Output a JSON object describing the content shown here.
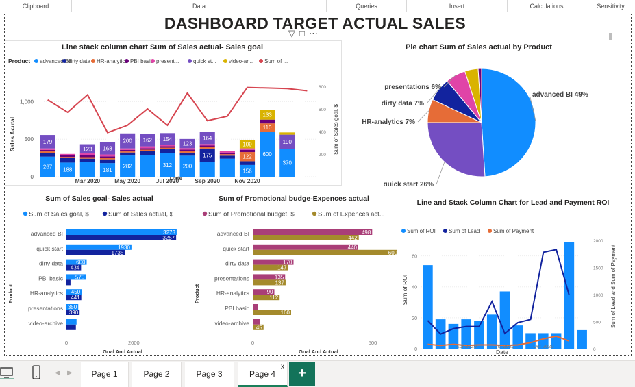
{
  "ribbon": {
    "items": [
      "Clipboard",
      "Data",
      "Queries",
      "Insert",
      "Calculations",
      "Sensitivity"
    ]
  },
  "dashboard": {
    "title": "DASHBOARD TARGET ACTUAL SALES"
  },
  "colors": {
    "advanced_bi": "#118DFF",
    "dirty_data": "#12239E",
    "hr_analytics": "#E66C37",
    "pbi_basic": "#6B007B",
    "presentations": "#E044A7",
    "quick_start": "#744EC2",
    "video_archive": "#D9B300",
    "goal_line": "#D64550",
    "budget": "#A93E78",
    "expences": "#A48A2C"
  },
  "chart_data": [
    {
      "id": "line-stack",
      "type": "bar",
      "title": "Line stack column chart Sum of Sales actual- Sales goal",
      "xlabel": "Date",
      "ylabel": "Sales Acutal",
      "y2label": "Sum of Sales goal, $",
      "legend_title": "Product",
      "legend": [
        "advanced BI",
        "dirty data",
        "HR-analytics",
        "PBI basic",
        "present...",
        "quick st...",
        "video-ar...",
        "Sum of ..."
      ],
      "x_ticks": [
        "Mar 2020",
        "May 2020",
        "Jul 2020",
        "Sep 2020",
        "Nov 2020"
      ],
      "y_ticks": [
        "0",
        "500",
        "1,000"
      ],
      "y2_ticks": [
        "200",
        "400",
        "600",
        "800"
      ],
      "ylim": [
        0,
        1250
      ],
      "y2lim": [
        0,
        830
      ],
      "categories": [
        "Jan 2020",
        "Feb 2020",
        "Mar 2020",
        "Apr 2020",
        "May 2020",
        "Jun 2020",
        "Jul 2020",
        "Aug 2020",
        "Sep 2020",
        "Oct 2020",
        "Nov 2020",
        "Dec 2020",
        "Jan 2021",
        "Feb 2021"
      ],
      "series": [
        {
          "key": "advanced_bi",
          "values": [
            267,
            188,
            200,
            181,
            282,
            290,
            312,
            280,
            200,
            240,
            156,
            600,
            370,
            0
          ]
        },
        {
          "key": "dirty_data",
          "values": [
            50,
            60,
            40,
            50,
            40,
            50,
            60,
            40,
            175,
            40,
            50,
            0,
            0,
            0
          ]
        },
        {
          "key": "hr_analytics",
          "values": [
            20,
            15,
            20,
            20,
            15,
            20,
            15,
            20,
            20,
            20,
            122,
            110,
            0,
            0
          ]
        },
        {
          "key": "pbi_basic",
          "values": [
            20,
            20,
            25,
            20,
            20,
            20,
            20,
            20,
            20,
            20,
            30,
            50,
            0,
            0
          ]
        },
        {
          "key": "presentations",
          "values": [
            20,
            20,
            25,
            25,
            20,
            25,
            20,
            20,
            20,
            20,
            20,
            0,
            0,
            0
          ]
        },
        {
          "key": "quick_start",
          "values": [
            179,
            0,
            123,
            168,
            200,
            162,
            154,
            123,
            164,
            0,
            0,
            0,
            190,
            0
          ]
        },
        {
          "key": "video_archive",
          "values": [
            0,
            0,
            0,
            0,
            0,
            0,
            0,
            0,
            0,
            0,
            109,
            133,
            30,
            0
          ]
        }
      ],
      "data_labels": [
        {
          "i": 0,
          "s": "advanced_bi",
          "text": "267"
        },
        {
          "i": 0,
          "s": "quick_start",
          "text": "179"
        },
        {
          "i": 1,
          "s": "advanced_bi",
          "text": "188"
        },
        {
          "i": 2,
          "s": "quick_start",
          "text": "123"
        },
        {
          "i": 3,
          "s": "advanced_bi",
          "text": "181"
        },
        {
          "i": 3,
          "s": "quick_start",
          "text": "168"
        },
        {
          "i": 4,
          "s": "advanced_bi",
          "text": "282"
        },
        {
          "i": 4,
          "s": "quick_start",
          "text": "200"
        },
        {
          "i": 5,
          "s": "quick_start",
          "text": "162"
        },
        {
          "i": 6,
          "s": "advanced_bi",
          "text": "312"
        },
        {
          "i": 6,
          "s": "quick_start",
          "text": "154"
        },
        {
          "i": 7,
          "s": "advanced_bi",
          "text": "200"
        },
        {
          "i": 7,
          "s": "quick_start",
          "text": "123"
        },
        {
          "i": 8,
          "s": "dirty_data",
          "text": "175"
        },
        {
          "i": 8,
          "s": "quick_start",
          "text": "164"
        },
        {
          "i": 10,
          "s": "advanced_bi",
          "text": "156"
        },
        {
          "i": 10,
          "s": "hr_analytics",
          "text": "122"
        },
        {
          "i": 10,
          "s": "video_archive",
          "text": "109"
        },
        {
          "i": 11,
          "s": "advanced_bi",
          "text": "600"
        },
        {
          "i": 11,
          "s": "hr_analytics",
          "text": "110"
        },
        {
          "i": 11,
          "s": "video_archive",
          "text": "133"
        },
        {
          "i": 12,
          "s": "advanced_bi",
          "text": "370"
        },
        {
          "i": 12,
          "s": "quick_start",
          "text": "190"
        }
      ],
      "line_goal": [
        680,
        570,
        725,
        390,
        455,
        600,
        455,
        740,
        495,
        535,
        790,
        785,
        780,
        760
      ]
    },
    {
      "id": "pie",
      "type": "pie",
      "title": "Pie chart Sum of Sales actual by Product",
      "slices": [
        {
          "key": "advanced_bi",
          "value": 49,
          "label": "advanced BI 49%"
        },
        {
          "key": "quick_start",
          "value": 26,
          "label": "quick start 26%"
        },
        {
          "key": "hr_analytics",
          "value": 7,
          "label": "HR-analytics 7%"
        },
        {
          "key": "dirty_data",
          "value": 7,
          "label": "dirty data 7%"
        },
        {
          "key": "presentations",
          "value": 6,
          "label": "presentations 6%"
        },
        {
          "key": "video_archive",
          "value": 4,
          "label": ""
        },
        {
          "key": "pbi_basic",
          "value": 1,
          "label": ""
        }
      ]
    },
    {
      "id": "goal-actual",
      "type": "bar",
      "title": "Sum of Sales goal- Sales actual",
      "legend": [
        "Sum of Sales goal, $",
        "Sum of Sales actual, $"
      ],
      "xlabel": "Goal And Actual",
      "ylabel": "Product",
      "x_ticks": [
        "0",
        "2000"
      ],
      "xlim": [
        0,
        3600
      ],
      "categories": [
        "advanced BI",
        "quick start",
        "dirty data",
        "PBI basic",
        "HR-analytics",
        "presentations",
        "video-archive"
      ],
      "series": [
        {
          "name": "Sum of Sales goal, $",
          "color": "#118DFF",
          "values": [
            3273,
            1930,
            600,
            575,
            450,
            350,
            300
          ]
        },
        {
          "name": "Sum of Sales actual, $",
          "color": "#12239E",
          "values": [
            3257,
            1735,
            434,
            120,
            441,
            390,
            280
          ]
        }
      ],
      "labels": [
        [
          "3273",
          "1930",
          "600",
          "575",
          "450",
          "350",
          ""
        ],
        [
          "3257",
          "1735",
          "434",
          "",
          "441",
          "390",
          ""
        ]
      ]
    },
    {
      "id": "budget-expences",
      "type": "bar",
      "title": "Sum of Promotional budge-Expences actual",
      "legend": [
        "Sum of Promotional budget, $",
        "Sum of Expences act..."
      ],
      "xlabel": "Goal And Actual",
      "ylabel": "Product",
      "x_ticks": [
        "0",
        "500"
      ],
      "xlim": [
        0,
        660
      ],
      "categories": [
        "advanced BI",
        "quick start",
        "dirty data",
        "presentations",
        "HR-analytics",
        "PBI basic",
        "video-archive"
      ],
      "series": [
        {
          "name": "Sum of Promotional budget, $",
          "color": "#A93E78",
          "values": [
            498,
            440,
            170,
            135,
            90,
            20,
            30
          ]
        },
        {
          "name": "Sum of Expences act...",
          "color": "#A48A2C",
          "values": [
            442,
            609,
            147,
            137,
            112,
            160,
            45
          ]
        }
      ],
      "labels": [
        [
          "498",
          "440",
          "170",
          "135",
          "90",
          "",
          ""
        ],
        [
          "442",
          "609",
          "147",
          "137",
          "112",
          "160",
          "45"
        ]
      ]
    },
    {
      "id": "lead-payment",
      "type": "bar",
      "title": "Line and Stack Column Chart for Lead and Payment ROI",
      "legend": [
        "Sum of ROI",
        "Sum of Lead",
        "Sum of Payment"
      ],
      "xlabel": "Date",
      "ylabel": "Sum of ROI",
      "y2label": "Sum of Lead and Sum of Payment",
      "x_ticks": [
        "Apr 2020",
        "Jul 2020",
        "Oct 2020"
      ],
      "y_ticks": [
        "0",
        "20",
        "40",
        "60"
      ],
      "y2_ticks": [
        "0",
        "500",
        "1000",
        "1500",
        "2000"
      ],
      "ylim": [
        0,
        70
      ],
      "y2lim": [
        0,
        2000
      ],
      "categories": [
        "Jan 2020",
        "Feb 2020",
        "Mar 2020",
        "Apr 2020",
        "May 2020",
        "Jun 2020",
        "Jul 2020",
        "Aug 2020",
        "Sep 2020",
        "Oct 2020",
        "Nov 2020",
        "Dec 2020",
        "Jan 2021"
      ],
      "roi": [
        54,
        19,
        16,
        19,
        18,
        22,
        37,
        15,
        10,
        10,
        10,
        69,
        12
      ],
      "lead": [
        520,
        270,
        370,
        410,
        410,
        870,
        280,
        480,
        540,
        1780,
        1830,
        990
      ],
      "payment": [
        80,
        60,
        80,
        60,
        70,
        70,
        60,
        70,
        110,
        180,
        230,
        140
      ]
    }
  ],
  "tabs": {
    "page1": "Page 1",
    "page2": "Page 2",
    "page3": "Page 3",
    "page4": "Page 4",
    "close": "x",
    "add": "+"
  }
}
